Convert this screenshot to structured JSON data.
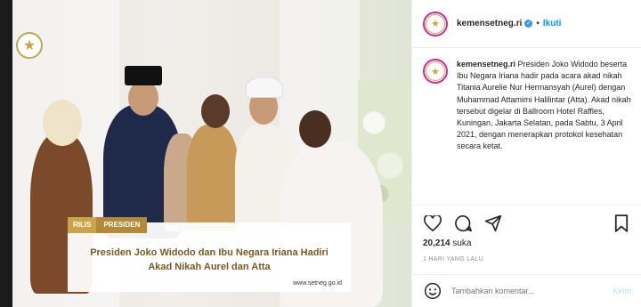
{
  "post": {
    "username": "kemensetneg.ri",
    "follow_label": "Ikuti",
    "separator": "•",
    "caption": "Presiden Joko Widodo beserta Ibu Negara Iriana hadir pada acara akad nikah Titania Aurelie Nur Hermansyah (Aurel) dengan Muhammad Attamimi Halilintar (Atta). Akad nikah tersebut digelar di Ballroom Hotel Raffles, Kuningan, Jakarta Selatan, pada Sabtu, 3 April 2021, dengan menerapkan protokol kesehatan secara ketat.",
    "likes_count": "20,214",
    "likes_label": "suka",
    "timestamp": "1 HARI YANG LALU"
  },
  "photo_overlay": {
    "tag1": "RILIS",
    "tag2": "PRESIDEN",
    "title": "Presiden Joko Widodo dan Ibu Negara Iriana Hadiri Akad Nikah Aurel dan Atta",
    "url": "www.setneg.go.id"
  },
  "comment": {
    "placeholder": "Tambahkan komentar...",
    "post_label": "Kirim"
  },
  "icons": {
    "like": "heart-icon",
    "comment": "comment-icon",
    "share": "share-icon",
    "save": "bookmark-icon",
    "emoji": "emoji-icon",
    "verified": "verified-badge-icon",
    "logo": "star-emblem-icon"
  },
  "colors": {
    "accent": "#0095f6",
    "verified": "#3897f0",
    "gold": "#c9a44a",
    "muted": "#8e8e8e"
  }
}
